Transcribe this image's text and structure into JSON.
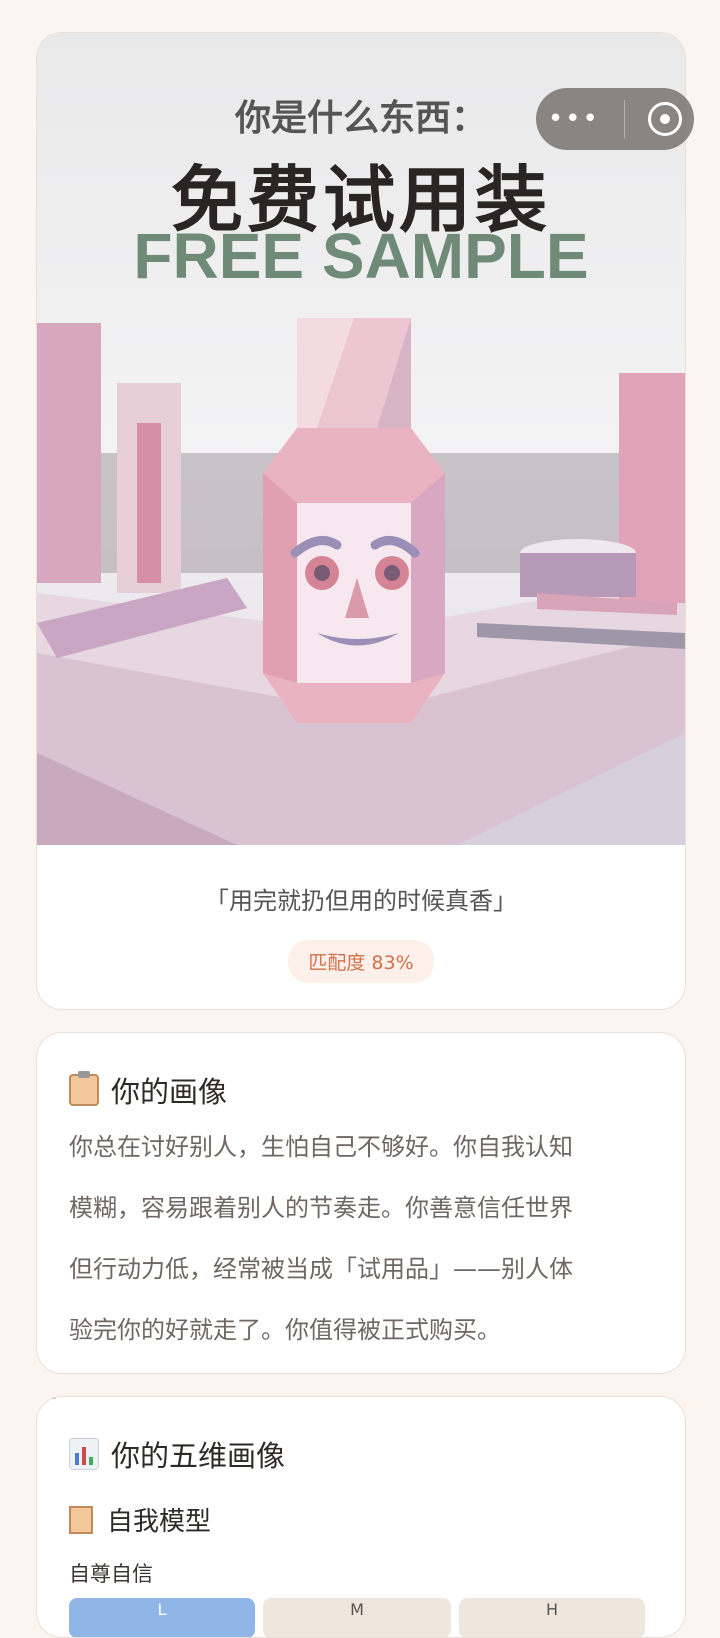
{
  "capsule": {
    "more_icon": "more-dots-icon",
    "close_icon": "target-icon"
  },
  "hero": {
    "question": "你是什么东西：",
    "title": "免费试用装",
    "title_en": "FREE SAMPLE",
    "quote": "「用完就扔但用的时候真香」",
    "match": "匹配度 83%",
    "colors": {
      "title_en": "#6f8b78",
      "badge_text": "#d2714a",
      "badge_bg": "#fdf0ea"
    }
  },
  "portrait": {
    "icon": "clipboard-icon",
    "title": "你的画像",
    "lines": [
      "你总在讨好别人，生怕自己不够好。你自我认知",
      "模糊，容易跟着别人的节奏走。你善意信任世界",
      "但行动力低，经常被当成「试用品」——别人体",
      "验完你的好就走了。你值得被正式购买。"
    ]
  },
  "dims": {
    "icon": "bar-chart-icon",
    "title": "你的五维画像",
    "sub_icon": "clipboard-icon",
    "sub_title": "自我模型",
    "item_label": "自尊自信",
    "levels": [
      "L",
      "M",
      "H"
    ],
    "selected_level": "L",
    "colors": {
      "selected": "#8fb6e6",
      "unselected": "#efe6dd"
    }
  }
}
